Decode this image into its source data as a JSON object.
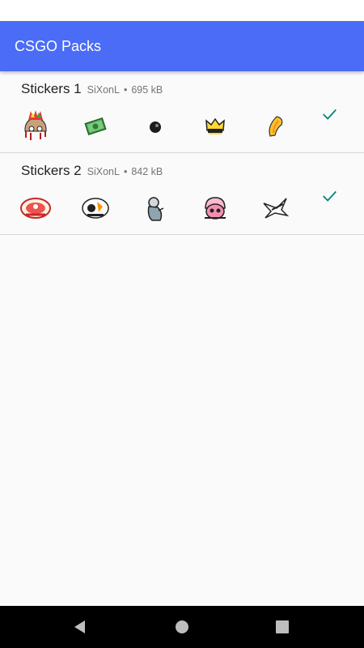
{
  "app_bar": {
    "title": "CSGO Packs",
    "color": "#4a6cf7"
  },
  "packs": [
    {
      "name": "Stickers 1",
      "author": "SiXonL",
      "separator": "•",
      "size": "695 kB",
      "added": true,
      "stickers": [
        "rainbow-mohawk-sticker",
        "cash-sticker",
        "eight-ball-sticker",
        "crown-sticker",
        "banana-sticker"
      ]
    },
    {
      "name": "Stickers 2",
      "author": "SiXonL",
      "separator": "•",
      "size": "842 kB",
      "added": true,
      "stickers": [
        "emblem-sticker",
        "team-logo-sticker",
        "zombie-sticker",
        "skull-cap-sticker",
        "eagle-sticker"
      ]
    }
  ],
  "check_color": "#00897b",
  "nav_bar": {
    "icons": [
      "back-icon",
      "home-icon",
      "recents-icon"
    ]
  }
}
